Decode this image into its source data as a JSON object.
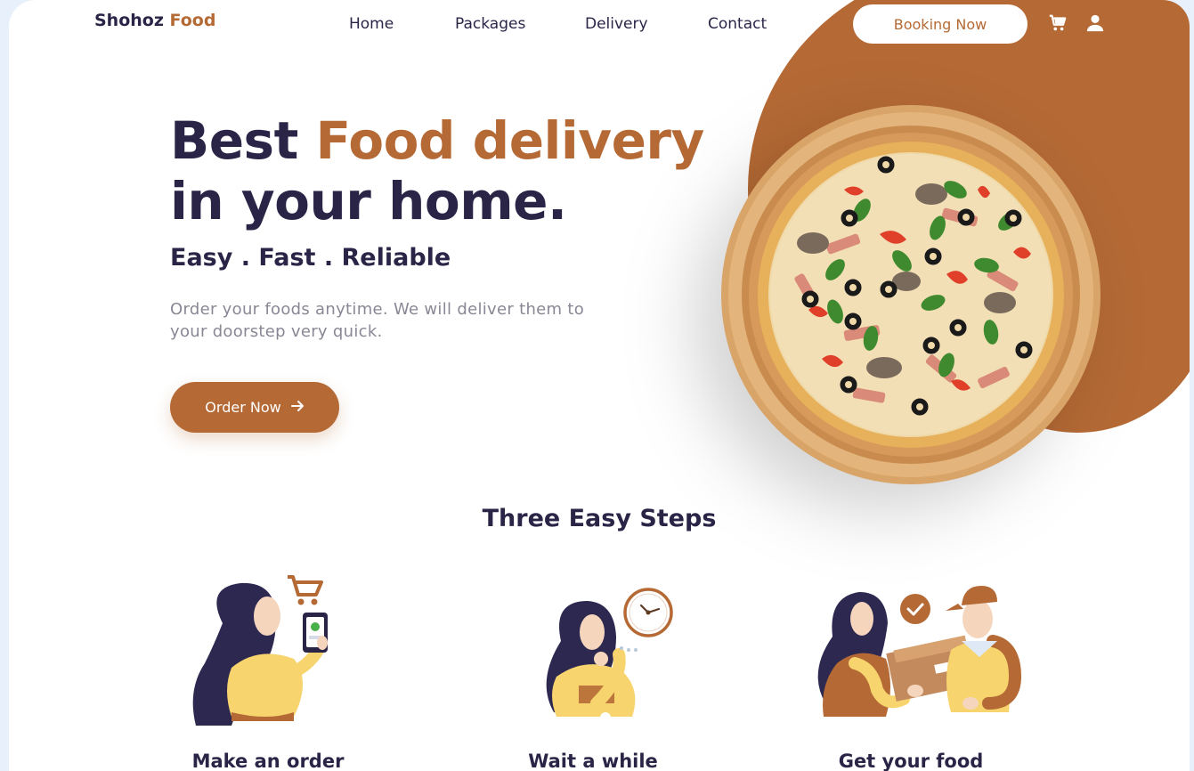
{
  "brand": {
    "name_part1": "Shohoz",
    "name_part2": "Food"
  },
  "nav": {
    "items": [
      "Home",
      "Packages",
      "Delivery",
      "Contact"
    ],
    "booking_label": "Booking Now"
  },
  "hero": {
    "title_part1": "Best",
    "title_accent": "Food delivery",
    "title_line2": "in your home.",
    "tagline": "Easy . Fast . Reliable",
    "description": "Order your foods anytime. We will deliver them to your doorstep very quick.",
    "cta_label": "Order Now"
  },
  "steps": {
    "title": "Three Easy Steps",
    "items": [
      {
        "label": "Make an order"
      },
      {
        "label": "Wait a while"
      },
      {
        "label": "Get your food"
      }
    ]
  },
  "colors": {
    "accent": "#b56a35",
    "dark": "#2a2547",
    "muted": "#8a8795",
    "background": "#ffffff"
  },
  "icons": [
    "cart-icon",
    "user-icon",
    "arrow-right-icon",
    "clock-icon",
    "checkmark-icon"
  ]
}
